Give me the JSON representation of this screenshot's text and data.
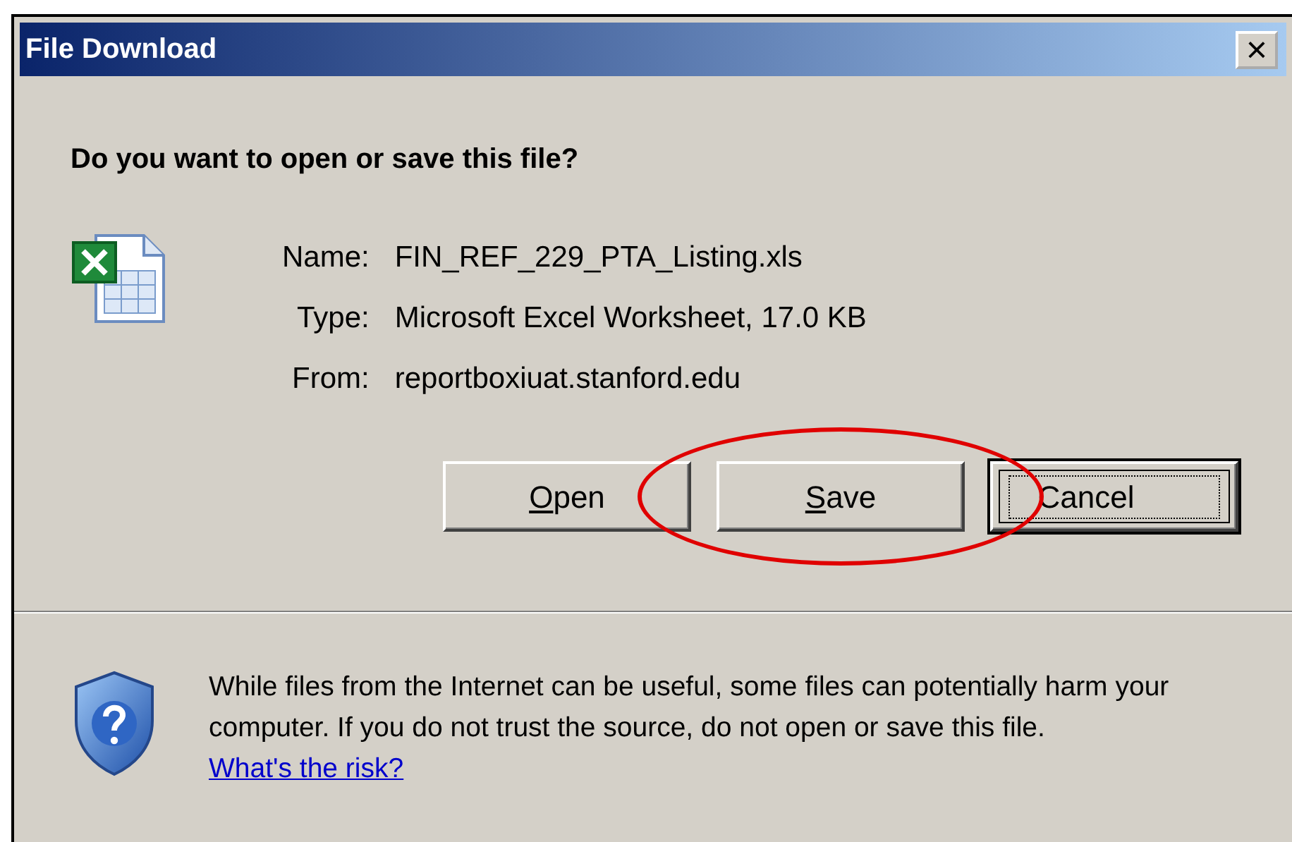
{
  "window": {
    "title": "File Download",
    "close": "×"
  },
  "question": "Do you want to open or save this file?",
  "file_info": [
    {
      "label": "Name:",
      "value": "FIN_REF_229_PTA_Listing.xls"
    },
    {
      "label": "Type:",
      "value": "Microsoft Excel Worksheet, 17.0 KB"
    },
    {
      "label": "From:",
      "value": "reportboxiuat.stanford.edu"
    }
  ],
  "buttons": [
    {
      "accel": "O",
      "rest": "pen",
      "focused": false,
      "circled": false
    },
    {
      "accel": "S",
      "rest": "ave",
      "focused": false,
      "circled": true
    },
    {
      "rest": "Cancel",
      "focused": true,
      "circled": false
    }
  ],
  "warning": {
    "text": "While files from the Internet can be useful, some files can potentially harm your computer. If you do not trust the source, do not open or save this file.",
    "link": "What's the risk?"
  }
}
